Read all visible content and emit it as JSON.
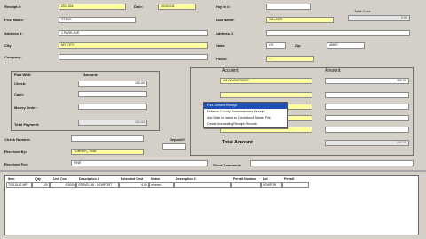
{
  "header": {
    "receipt_label": "Receipt #:",
    "receipt_value": "2011001",
    "date_label": "Date:",
    "date_value": "3/24/2011",
    "pay_label": "Pay to #:",
    "total_cost_label": "Total Cost:",
    "total_cost_value": "0.00"
  },
  "payer": {
    "first_name_label": "First Name:",
    "first_name": "STEVE",
    "last_name_label": "Last Name:",
    "last_name": "WALKER",
    "address1_label": "Address 1:",
    "address1": "1 PARK AVE",
    "address2_label": "Address 2:",
    "address2": "",
    "city_label": "City:",
    "city": "MY CITY",
    "state_label": "State:",
    "state": "OH",
    "zip_label": "Zip:",
    "zip": "45697",
    "company_label": "Company:",
    "company": "",
    "phone_label": "Phone:",
    "phone": "- -"
  },
  "payment": {
    "paid_with_label": "Paid With:",
    "amount_label": "Amount:",
    "check_label": "Check:",
    "check_amount": "150.00",
    "cash_label": "Cash:",
    "money_order_label": "Money Order:",
    "total_payment_label": "Total Payment:",
    "total_payment": "150.00",
    "check_number_label": "Check Number:",
    "received_by_label": "Received By:",
    "received_by": "TURNER_TINA",
    "received_for_label": "Received For:",
    "received_for": "FINE",
    "deposit_label": "Deposit?"
  },
  "accounts": {
    "account_label": "Account:",
    "amount_label": "Amount:",
    "account1": "A0L0010W750007",
    "amount1": "150.00",
    "total_amount_label": "Total Amount",
    "total_amount": "150.00",
    "short_comment_label": "Short Comment:"
  },
  "context_menu": {
    "items": [
      "Print Generic Receipt",
      "Defiance County Commissioners Receipt",
      "Add Walk In Name to Constituent Master File",
      "Create Accounting Receipt Records"
    ]
  },
  "grid": {
    "columns": [
      "Item",
      "Qty",
      "Unit Cost",
      "Description 1",
      "Extended Cost",
      "Notes",
      "Description 2",
      "Permit Number",
      "Lot",
      "Permit"
    ],
    "row": [
      "T031DUO.WP",
      "1.00",
      "6.5000",
      "GRAVEL #8 - NEWPORT",
      "6.50",
      "mmmm",
      "",
      "",
      "NEWPOR",
      ""
    ]
  },
  "colors": {
    "form_bg": "#d4d0c8",
    "required_field": "#fffea0",
    "menu_highlight": "#1f4fb8"
  }
}
